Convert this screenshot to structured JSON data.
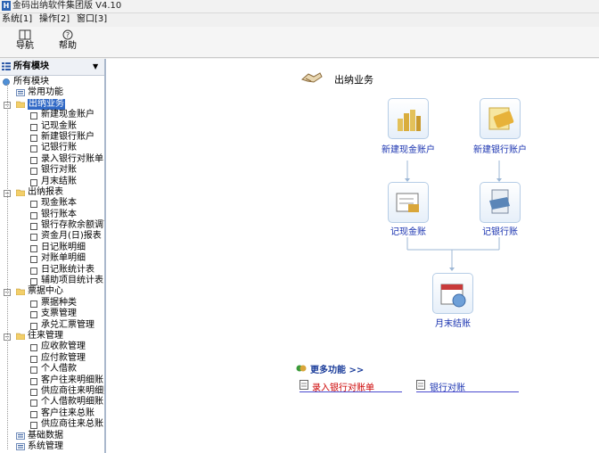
{
  "window": {
    "title": "金码出纳软件集团版  V4.10"
  },
  "menubar": {
    "items": [
      "系统[1]",
      "操作[2]",
      "窗口[3]"
    ]
  },
  "toolbar": {
    "buttons": [
      {
        "label": "导航",
        "icon": "navigation-icon"
      },
      {
        "label": "帮助",
        "icon": "help-icon"
      }
    ]
  },
  "left_panel": {
    "header": "所有模块",
    "tree": [
      {
        "label": "所有模块",
        "type": "root"
      },
      {
        "label": "常用功能",
        "type": "folder"
      },
      {
        "label": "出纳业务",
        "type": "folder",
        "expanded": true,
        "selected": true,
        "children": [
          "新建现金账户",
          "记现金账",
          "新建银行账户",
          "记银行账",
          "录入银行对账单",
          "银行对账",
          "月末结账"
        ]
      },
      {
        "label": "出纳报表",
        "type": "folder",
        "expanded": true,
        "children": [
          "现金账本",
          "银行账本",
          "银行存款余额调节表",
          "资金月(日)报表",
          "日记账明细",
          "对账单明细",
          "日记账统计表",
          "辅助项目统计表"
        ]
      },
      {
        "label": "票据中心",
        "type": "folder",
        "expanded": true,
        "children": [
          "票据种类",
          "支票管理",
          "承兑汇票管理"
        ]
      },
      {
        "label": "往来管理",
        "type": "folder",
        "expanded": true,
        "children": [
          "应收款管理",
          "应付款管理",
          "个人借款",
          "客户往来明细账",
          "供应商往来明细账",
          "个人借款明细账",
          "客户往来总账",
          "供应商往来总账"
        ]
      },
      {
        "label": "基础数据",
        "type": "folder"
      },
      {
        "label": "系统管理",
        "type": "folder"
      }
    ]
  },
  "main": {
    "section_title": "出纳业务",
    "flow_nodes": [
      {
        "label": "新建现金账户",
        "icon": "cash-account-icon"
      },
      {
        "label": "新建银行账户",
        "icon": "bank-account-icon"
      },
      {
        "label": "记现金账",
        "icon": "cash-journal-icon"
      },
      {
        "label": "记银行账",
        "icon": "bank-journal-icon"
      },
      {
        "label": "月末结账",
        "icon": "month-end-icon"
      }
    ],
    "more": {
      "title": "更多功能 >>",
      "links": [
        "录入银行对账单",
        "银行对账"
      ]
    }
  },
  "colors": {
    "selection": "#3169c6",
    "link": "#1a33b0",
    "more_link_red": "#cc0000",
    "underline": "#4b4bd0"
  }
}
